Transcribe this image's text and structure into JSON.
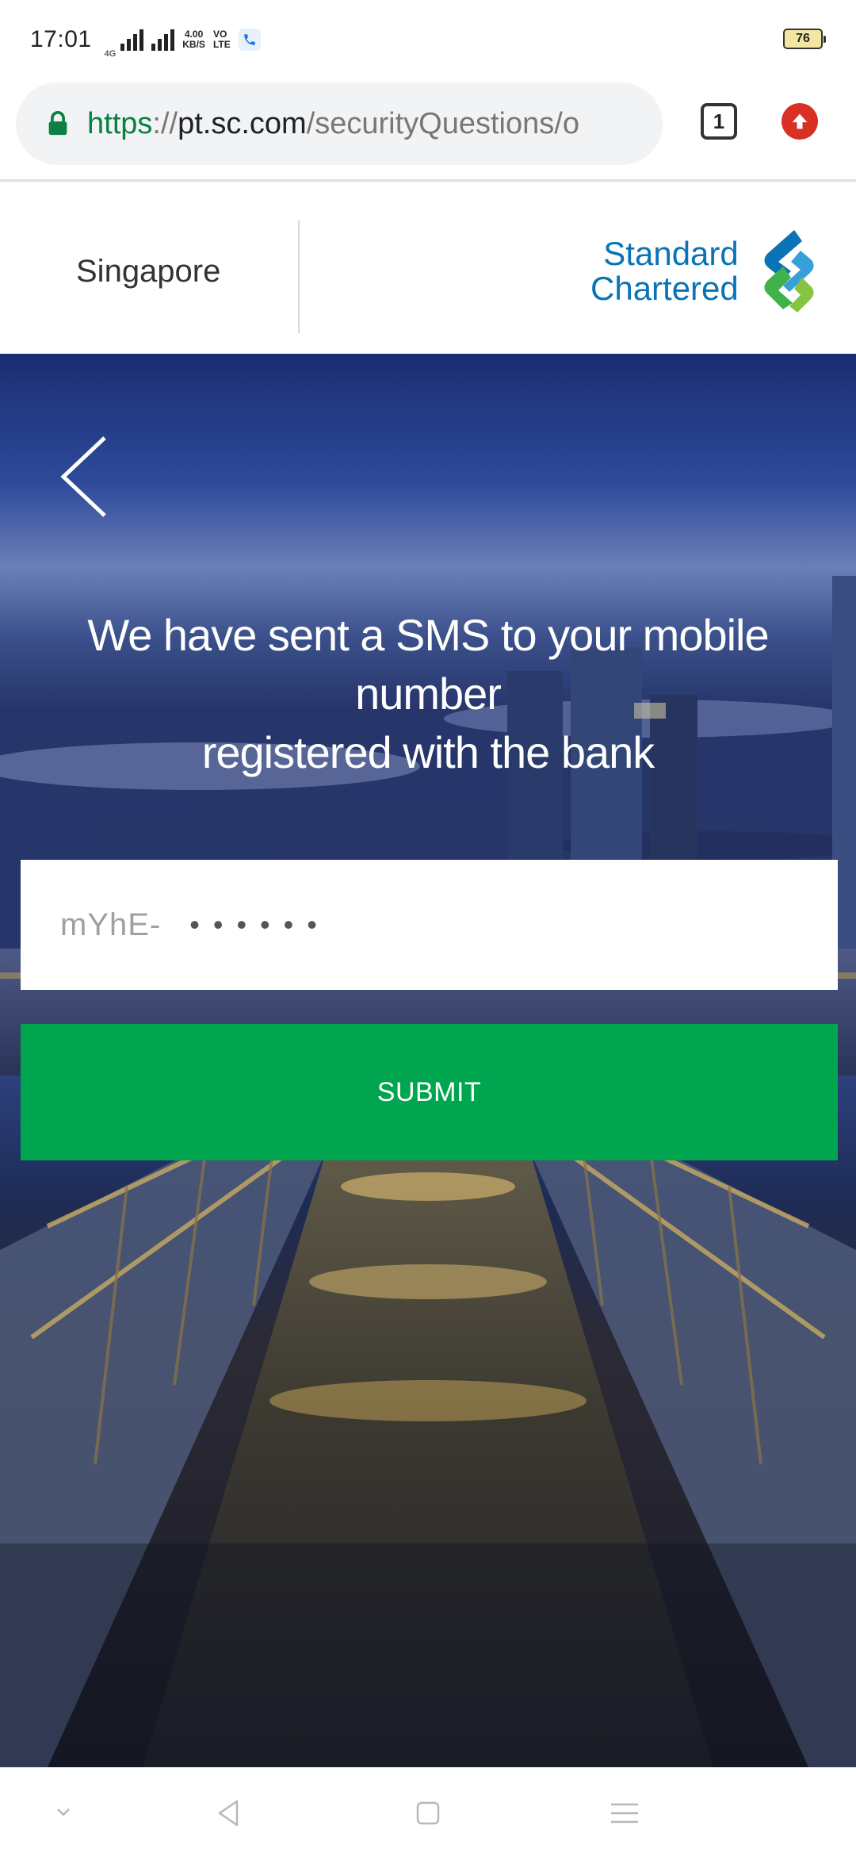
{
  "status_bar": {
    "time": "17:01",
    "network_type": "4G",
    "net_speed_value": "4.00",
    "net_speed_unit": "KB/S",
    "volte_top": "VO",
    "volte_bottom": "LTE",
    "battery": "76"
  },
  "browser": {
    "url_scheme": "https",
    "url_separator": "://",
    "url_host": "pt.sc.com",
    "url_path": "/securityQuestions/o",
    "tab_count": "1"
  },
  "header": {
    "country": "Singapore",
    "logo_line1": "Standard",
    "logo_line2": "Chartered"
  },
  "verification": {
    "message_line1": "We have sent a SMS to your mobile",
    "message_line2": "number",
    "message_line3": "registered with the bank",
    "otp_prefix": "mYhE-",
    "otp_masked": "••••••",
    "submit_label": "SUBMIT"
  },
  "colors": {
    "brand_blue": "#0a73b6",
    "brand_green": "#00a64f",
    "secure_green": "#0b8043",
    "update_red": "#d93025"
  },
  "icons": [
    "lock-icon",
    "tab-switcher-icon",
    "update-icon",
    "back-arrow-icon",
    "call-icon",
    "chevron-down-icon",
    "nav-back-icon",
    "nav-home-icon",
    "nav-menu-icon"
  ]
}
